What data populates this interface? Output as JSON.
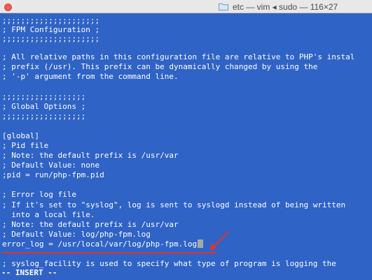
{
  "window": {
    "title": "etc — vim ◂ sudo — 116×27",
    "icons": {
      "folder": "folder-icon",
      "close": "close-icon"
    }
  },
  "editor": {
    "lines": [
      ";;;;;;;;;;;;;;;;;;;;;",
      "; FPM Configuration ;",
      ";;;;;;;;;;;;;;;;;;;;;",
      "",
      "; All relative paths in this configuration file are relative to PHP's instal",
      "; prefix (/usr). This prefix can be dynamically changed by using the",
      "; '-p' argument from the command line.",
      "",
      ";;;;;;;;;;;;;;;;;;",
      "; Global Options ;",
      ";;;;;;;;;;;;;;;;;;",
      "",
      "[global]",
      "; Pid file",
      "; Note: the default prefix is /usr/var",
      "; Default Value: none",
      ";pid = run/php-fpm.pid",
      "",
      "; Error log file",
      "; If it's set to \"syslog\", log is sent to syslogd instead of being written",
      "  into a local file.",
      "; Note: the default prefix is /usr/var",
      "; Default Value: log/php-fpm.log",
      "error_log = /usr/local/var/log/php-fpm.log",
      "",
      "; syslog_facility is used to specify what type of program is logging the"
    ],
    "status_line": "-- INSERT --"
  },
  "annotation": {
    "color": "#e0342c"
  }
}
